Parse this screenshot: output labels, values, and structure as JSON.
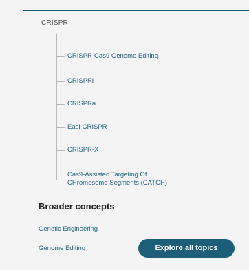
{
  "tree": {
    "root_label": "CRISPR",
    "children": [
      {
        "label": "CRISPR-Cas9 Genome Editing"
      },
      {
        "label": "CRISPRi"
      },
      {
        "label": "CRISPRa"
      },
      {
        "label": "Easi-CRISPR"
      },
      {
        "label": "CRISPR-X"
      },
      {
        "label_line1": "Cas9-Assisted Targeting Of",
        "label_line2": "CHromosome Segments (CATCH)"
      }
    ]
  },
  "broader": {
    "title": "Broader concepts",
    "items": [
      {
        "label": "Genetic Engineering"
      },
      {
        "label": "Genome Editing"
      }
    ]
  },
  "explore_button": {
    "label": "Explore all topics"
  },
  "colors": {
    "accent": "#1d5f78",
    "link": "#236782",
    "rule": "#1f5f7a"
  }
}
